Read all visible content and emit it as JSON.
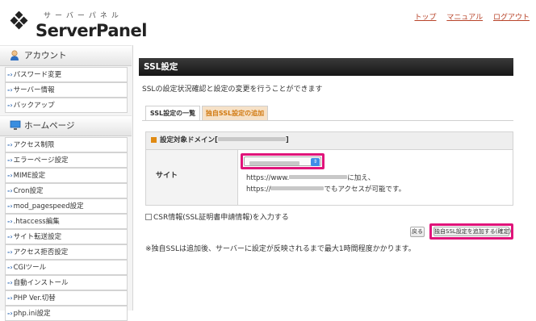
{
  "header": {
    "logo_sub": "サーバーパネル",
    "logo_main": "ServerPanel",
    "links": [
      "トップ",
      "マニュアル",
      "ログアウト"
    ]
  },
  "sidebar": {
    "sections": [
      {
        "title": "アカウント",
        "icon": "person-icon",
        "items": [
          "パスワード変更",
          "サーバー情報",
          "バックアップ"
        ]
      },
      {
        "title": "ホームページ",
        "icon": "monitor-icon",
        "items": [
          "アクセス制限",
          "エラーページ設定",
          "MIME設定",
          "Cron設定",
          "mod_pagespeed設定",
          ".htaccess編集",
          "サイト転送設定",
          "アクセス拒否設定",
          "CGIツール",
          "自動インストール",
          "PHP Ver.切替",
          "php.ini設定"
        ]
      }
    ],
    "arrow": "-›"
  },
  "main": {
    "title": "SSL設定",
    "description": "SSLの設定状況確認と設定の変更を行うことができます",
    "tabs": [
      "SSL設定の一覧",
      "独自SSL設定の追加"
    ],
    "active_tab": 1,
    "panel": {
      "heading_prefix": "設定対象ドメイン[",
      "heading_suffix": "]",
      "row_label": "サイト",
      "url_prefix_1": "https://www.",
      "url_suffix_1": "に加え、",
      "url_prefix_2": "https://",
      "url_suffix_2": "でもアクセスが可能です。"
    },
    "csr_label": "CSR情報(SSL証明書申請情報)を入力する",
    "back_button": "戻る",
    "submit_button": "独自SSL設定を追加する(確定)",
    "note": "※独自SSLは追加後、サーバーに設定が反映されるまで最大1時間程度かかります。"
  },
  "colors": {
    "accent": "#e0147a",
    "tab_active_text": "#d17a12",
    "link": "#b8442a",
    "title_bar": "#1e1e1e"
  }
}
